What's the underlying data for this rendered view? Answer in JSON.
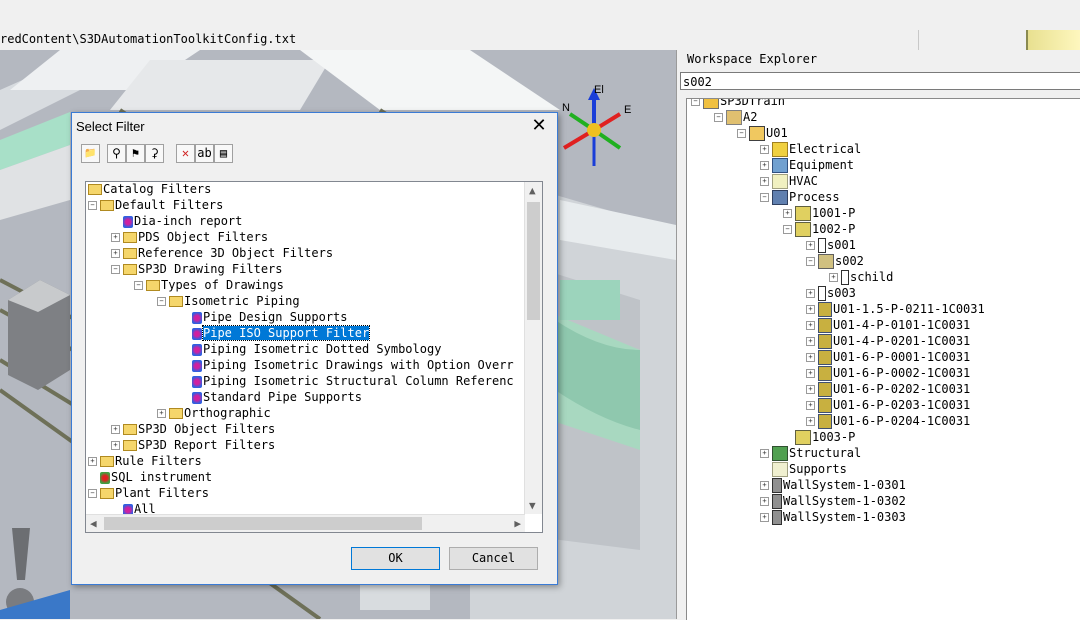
{
  "top": {
    "path_text": "redContent\\S3DAutomationToolkitConfig.txt"
  },
  "compass": {
    "n": "N",
    "el": "El",
    "e": "E"
  },
  "workspace": {
    "title": "Workspace Explorer",
    "search_value": "s002",
    "tree": [
      {
        "label": "SP3DTrain",
        "icon": "plant-icon",
        "exp": "-"
      },
      {
        "label": "A2",
        "icon": "area-icon",
        "exp": "-"
      },
      {
        "label": "U01",
        "icon": "unit-icon",
        "exp": "-"
      },
      {
        "label": "Electrical",
        "icon": "electrical-icon",
        "exp": "+"
      },
      {
        "label": "Equipment",
        "icon": "equipment-icon",
        "exp": "+"
      },
      {
        "label": "HVAC",
        "icon": "hvac-icon",
        "exp": "+"
      },
      {
        "label": "Process",
        "icon": "process-icon",
        "exp": "-"
      },
      {
        "label": "1001-P",
        "icon": "pipeline-icon",
        "exp": "+"
      },
      {
        "label": "1002-P",
        "icon": "pipeline-icon",
        "exp": "-"
      },
      {
        "label": "s001",
        "icon": "support-icon",
        "exp": "+"
      },
      {
        "label": "s002",
        "icon": "support-assembly-icon",
        "exp": "-"
      },
      {
        "label": "schild",
        "icon": "support-icon",
        "exp": "+"
      },
      {
        "label": "s003",
        "icon": "support-icon",
        "exp": "+"
      },
      {
        "label": "U01-1.5-P-0211-1C0031",
        "icon": "pipe-run-icon",
        "exp": "+"
      },
      {
        "label": "U01-4-P-0101-1C0031",
        "icon": "pipe-run-icon",
        "exp": "+"
      },
      {
        "label": "U01-4-P-0201-1C0031",
        "icon": "pipe-run-icon",
        "exp": "+"
      },
      {
        "label": "U01-6-P-0001-1C0031",
        "icon": "pipe-run-icon",
        "exp": "+"
      },
      {
        "label": "U01-6-P-0002-1C0031",
        "icon": "pipe-run-icon",
        "exp": "+"
      },
      {
        "label": "U01-6-P-0202-1C0031",
        "icon": "pipe-run-icon",
        "exp": "+"
      },
      {
        "label": "U01-6-P-0203-1C0031",
        "icon": "pipe-run-icon",
        "exp": "+"
      },
      {
        "label": "U01-6-P-0204-1C0031",
        "icon": "pipe-run-icon",
        "exp": "+"
      },
      {
        "label": "1003-P",
        "icon": "pipeline-icon",
        "exp": ""
      },
      {
        "label": "Structural",
        "icon": "structural-icon",
        "exp": "+"
      },
      {
        "label": "Supports",
        "icon": "supports-icon",
        "exp": ""
      },
      {
        "label": "WallSystem-1-0301",
        "icon": "wall-icon",
        "exp": "+"
      },
      {
        "label": "WallSystem-1-0302",
        "icon": "wall-icon",
        "exp": "+"
      },
      {
        "label": "WallSystem-1-0303",
        "icon": "wall-icon",
        "exp": "+"
      }
    ]
  },
  "dialog": {
    "title": "Select Filter",
    "close_glyph": "✕",
    "ok_label": "OK",
    "cancel_label": "Cancel",
    "toolbar": [
      {
        "name": "new-folder-icon",
        "glyph": "📁"
      },
      {
        "name": "new-filter-icon",
        "glyph": "⚲"
      },
      {
        "name": "new-asking-filter-icon",
        "glyph": "⚑"
      },
      {
        "name": "new-sql-filter-icon",
        "glyph": "⚳"
      },
      {
        "name": "delete-icon",
        "glyph": "✕"
      },
      {
        "name": "rename-icon",
        "glyph": "ab"
      },
      {
        "name": "properties-icon",
        "glyph": "▤"
      }
    ],
    "tree": [
      {
        "label": "Catalog Filters",
        "icon": "folder-icon",
        "exp": ""
      },
      {
        "label": "Default Filters",
        "icon": "folder-icon",
        "exp": "-"
      },
      {
        "label": "Dia-inch report",
        "icon": "filter-icon",
        "exp": ""
      },
      {
        "label": "PDS Object Filters",
        "icon": "folder-icon",
        "exp": "+"
      },
      {
        "label": "Reference 3D Object Filters",
        "icon": "folder-icon",
        "exp": "+"
      },
      {
        "label": "SP3D Drawing Filters",
        "icon": "folder-icon",
        "exp": "-"
      },
      {
        "label": "Types of Drawings",
        "icon": "folder-icon",
        "exp": "-"
      },
      {
        "label": "Isometric Piping",
        "icon": "folder-icon",
        "exp": "-"
      },
      {
        "label": "Pipe Design Supports",
        "icon": "filter-icon",
        "exp": ""
      },
      {
        "label": "Pipe ISO Support Filter",
        "icon": "filter-icon",
        "exp": "",
        "selected": true
      },
      {
        "label": "Piping Isometric Dotted Symbology",
        "icon": "filter-icon",
        "exp": ""
      },
      {
        "label": "Piping Isometric Drawings with Option Overr",
        "icon": "filter-icon",
        "exp": ""
      },
      {
        "label": "Piping Isometric Structural Column Referenc",
        "icon": "filter-icon",
        "exp": ""
      },
      {
        "label": "Standard Pipe Supports",
        "icon": "filter-icon",
        "exp": ""
      },
      {
        "label": "Orthographic",
        "icon": "folder-icon",
        "exp": "+"
      },
      {
        "label": "SP3D Object Filters",
        "icon": "folder-icon",
        "exp": "+"
      },
      {
        "label": "SP3D Report Filters",
        "icon": "folder-icon",
        "exp": "+"
      },
      {
        "label": "Rule Filters",
        "icon": "folder-icon",
        "exp": "+"
      },
      {
        "label": "SQL instrument",
        "icon": "sql-filter-icon",
        "exp": ""
      },
      {
        "label": "Plant Filters",
        "icon": "folder-icon",
        "exp": "-"
      },
      {
        "label": "All",
        "icon": "filter-icon",
        "exp": ""
      }
    ]
  }
}
